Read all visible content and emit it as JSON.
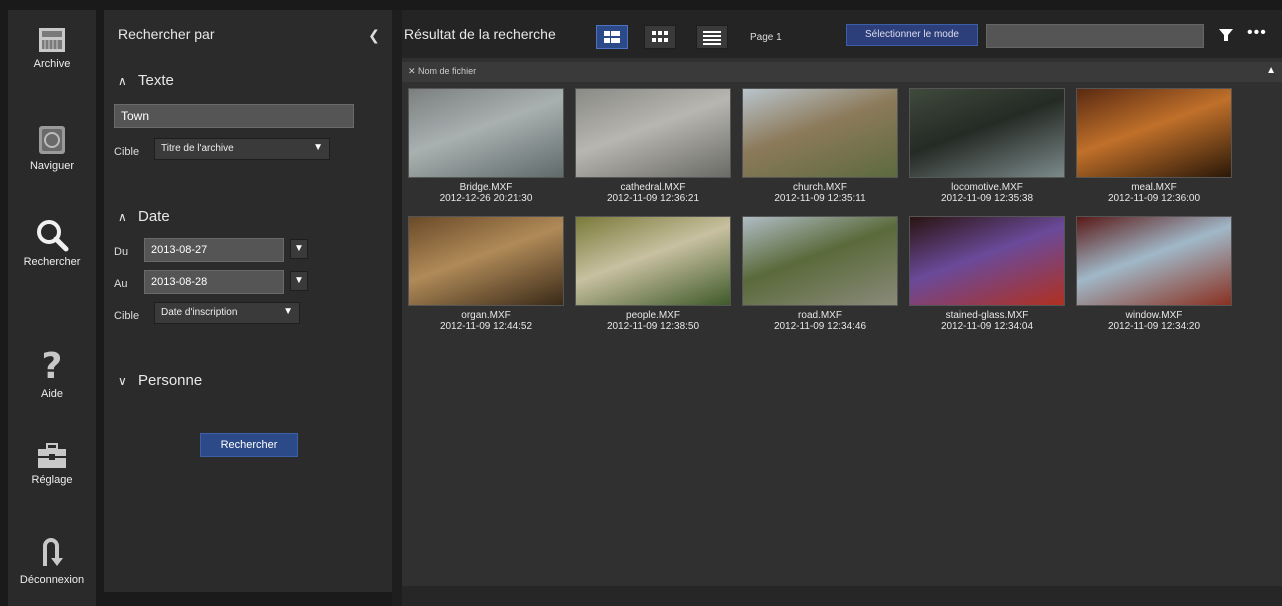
{
  "nav": {
    "items": [
      {
        "label": "Archive",
        "icon": "archive-icon"
      },
      {
        "label": "Naviguer",
        "icon": "browse-icon"
      },
      {
        "label": "Rechercher",
        "icon": "search-icon"
      },
      {
        "label": "Aide",
        "icon": "help-icon"
      },
      {
        "label": "Réglage",
        "icon": "toolbox-icon"
      },
      {
        "label": "Déconnexion",
        "icon": "logout-icon"
      }
    ]
  },
  "panel": {
    "title": "Rechercher par",
    "text_section": {
      "heading": "Texte",
      "value": "Town",
      "target_label": "Cible",
      "target_value": "Titre de l'archive"
    },
    "date_section": {
      "heading": "Date",
      "from_label": "Du",
      "from_value": "2013-08-27",
      "to_label": "Au",
      "to_value": "2013-08-28",
      "target_label": "Cible",
      "target_value": "Date d'inscription"
    },
    "person_section": {
      "heading": "Personne"
    },
    "search_button": "Rechercher"
  },
  "results": {
    "title": "Résultat de la recherche",
    "page_label": "Page 1",
    "mode_button": "Sélectionner le mode",
    "sort_label": "Nom de fichier",
    "items": [
      {
        "name": "Bridge.MXF",
        "date": "2012-12-26 20:21:30",
        "colors": [
          "#7b7f80",
          "#a9b0b0",
          "#5f6a6a"
        ]
      },
      {
        "name": "cathedral.MXF",
        "date": "2012-11-09 12:36:21",
        "colors": [
          "#8a8a86",
          "#b7b6b0",
          "#6a6a66"
        ]
      },
      {
        "name": "church.MXF",
        "date": "2012-11-09 12:35:11",
        "colors": [
          "#b9c4cc",
          "#8c7a5a",
          "#5d6a3f"
        ]
      },
      {
        "name": "locomotive.MXF",
        "date": "2012-11-09 12:35:38",
        "colors": [
          "#3f4a3c",
          "#252a25",
          "#7b8a8a"
        ]
      },
      {
        "name": "meal.MXF",
        "date": "2012-11-09 12:36:00",
        "colors": [
          "#5a2a12",
          "#c0702a",
          "#2a1808"
        ]
      },
      {
        "name": "organ.MXF",
        "date": "2012-11-09 12:44:52",
        "colors": [
          "#6a4a28",
          "#b08a58",
          "#3a2a18"
        ]
      },
      {
        "name": "people.MXF",
        "date": "2012-11-09 12:38:50",
        "colors": [
          "#7a7a3a",
          "#c8c0a0",
          "#3f5a2a"
        ]
      },
      {
        "name": "road.MXF",
        "date": "2012-11-09 12:34:46",
        "colors": [
          "#b0bcc4",
          "#5a6a3a",
          "#8a8a7a"
        ]
      },
      {
        "name": "stained-glass.MXF",
        "date": "2012-11-09 12:34:04",
        "colors": [
          "#2a1410",
          "#6a4a9a",
          "#b03020"
        ]
      },
      {
        "name": "window.MXF",
        "date": "2012-11-09 12:34:20",
        "colors": [
          "#5a1a18",
          "#a0b8c8",
          "#8a3020"
        ]
      }
    ]
  }
}
